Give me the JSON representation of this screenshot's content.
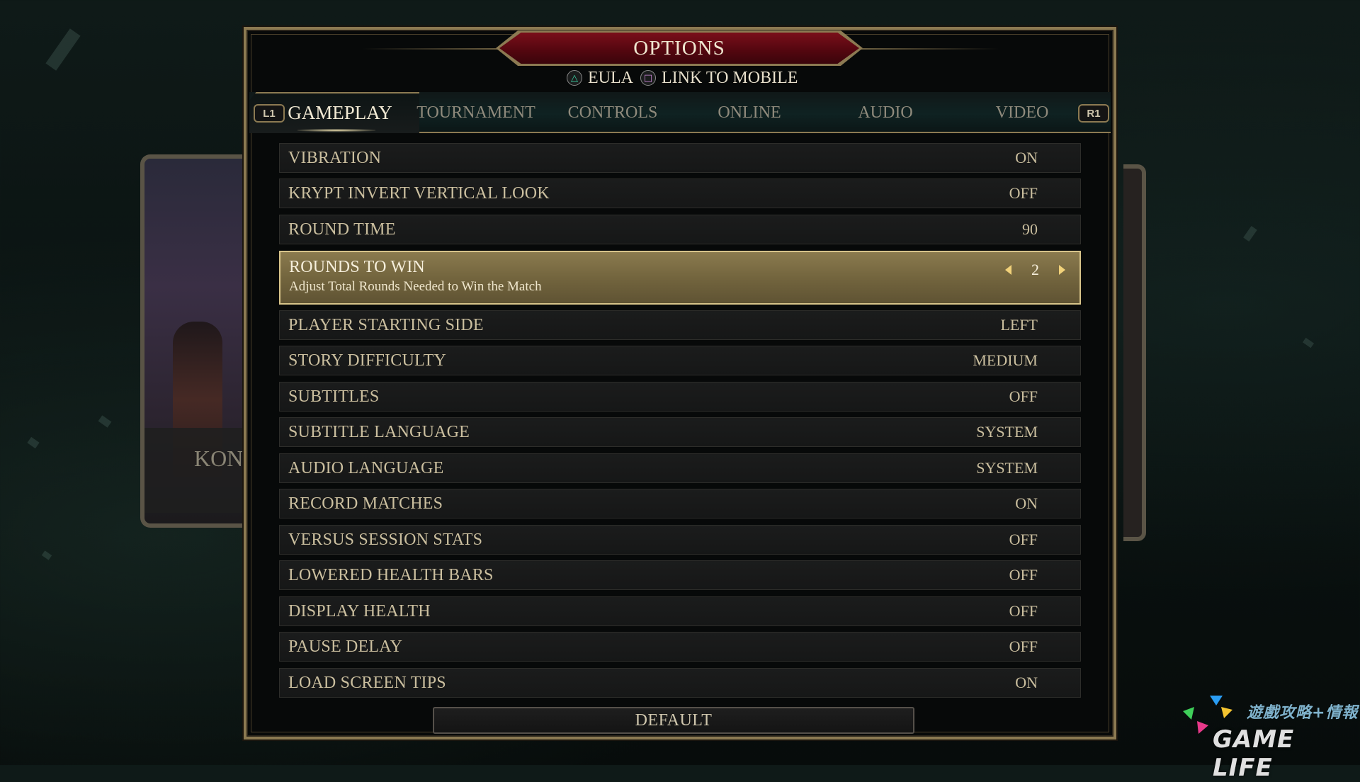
{
  "header": {
    "title": "OPTIONS",
    "actions": [
      {
        "glyph": "△",
        "icon": "triangle-button-icon",
        "label": "EULA"
      },
      {
        "glyph": "□",
        "icon": "square-button-icon",
        "label": "LINK TO MOBILE"
      }
    ]
  },
  "tabs": {
    "left_bumper": "L1",
    "right_bumper": "R1",
    "items": [
      {
        "label": "GAMEPLAY",
        "active": true
      },
      {
        "label": "TOURNAMENT"
      },
      {
        "label": "CONTROLS"
      },
      {
        "label": "ONLINE"
      },
      {
        "label": "AUDIO"
      },
      {
        "label": "VIDEO"
      }
    ]
  },
  "settings": [
    {
      "label": "VIBRATION",
      "value": "ON"
    },
    {
      "label": "KRYPT INVERT VERTICAL LOOK",
      "value": "OFF"
    },
    {
      "label": "ROUND TIME",
      "value": "90"
    },
    {
      "label": "ROUNDS TO WIN",
      "value": "2",
      "description": "Adjust Total Rounds Needed to Win the Match",
      "selected": true
    },
    {
      "label": "PLAYER STARTING SIDE",
      "value": "LEFT"
    },
    {
      "label": "STORY DIFFICULTY",
      "value": "MEDIUM"
    },
    {
      "label": "SUBTITLES",
      "value": "OFF"
    },
    {
      "label": "SUBTITLE LANGUAGE",
      "value": "SYSTEM"
    },
    {
      "label": "AUDIO LANGUAGE",
      "value": "SYSTEM"
    },
    {
      "label": "RECORD MATCHES",
      "value": "ON"
    },
    {
      "label": "VERSUS SESSION STATS",
      "value": "OFF"
    },
    {
      "label": "LOWERED HEALTH BARS",
      "value": "OFF"
    },
    {
      "label": "DISPLAY HEALTH",
      "value": "OFF"
    },
    {
      "label": "PAUSE DELAY",
      "value": "OFF"
    },
    {
      "label": "LOAD SCREEN TIPS",
      "value": "ON"
    }
  ],
  "footer": {
    "default_label": "DEFAULT"
  },
  "background": {
    "card_text": "KON"
  },
  "watermark": {
    "cn": "遊戲攻略+情報",
    "en": "GAME LIFE"
  },
  "colors": {
    "gold_border": "#8c7a52",
    "header_red": "#7a0f1a",
    "selected_row": "#8a7a4e",
    "text": "#cbbf9f",
    "arrow": "#f2d27a"
  }
}
